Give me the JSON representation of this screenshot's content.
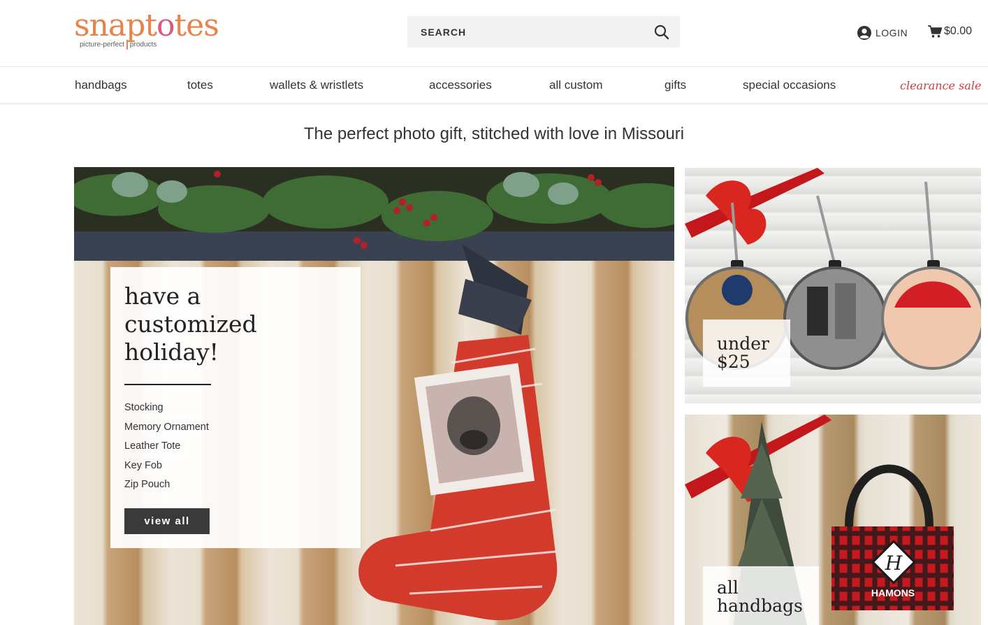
{
  "brand": {
    "name_part1": "snapt",
    "name_part2": "o",
    "name_part3": "tes",
    "tagline_left": "picture-perfect",
    "tagline_right": "products",
    "colors": {
      "orange": "#e8834b",
      "pink": "#d85c7a",
      "sale_red": "#c83f3f"
    }
  },
  "search": {
    "placeholder": "SEARCH",
    "icon": "search-icon"
  },
  "account": {
    "login_label": "LOGIN",
    "login_icon": "user-circle-icon"
  },
  "cart": {
    "total": "$0.00",
    "icon": "cart-icon"
  },
  "nav": {
    "items": [
      {
        "label": "handbags"
      },
      {
        "label": "totes"
      },
      {
        "label": "wallets & wristlets"
      },
      {
        "label": "accessories"
      },
      {
        "label": "all custom"
      },
      {
        "label": "gifts"
      },
      {
        "label": "special occasions"
      },
      {
        "label": "clearance sale"
      }
    ]
  },
  "tagline": "The perfect photo gift, stitched with love in Missouri",
  "hero": {
    "title": "have a\ncustomized\nholiday!",
    "items": [
      "Stocking",
      "Memory Ornament",
      "Leather Tote",
      "Key Fob",
      "Zip Pouch"
    ],
    "button_label": "view all"
  },
  "tiles": [
    {
      "label": "under\n$25"
    },
    {
      "label": "all\nhandbags",
      "bag_monogram": "H",
      "bag_name": "HAMONS"
    }
  ]
}
